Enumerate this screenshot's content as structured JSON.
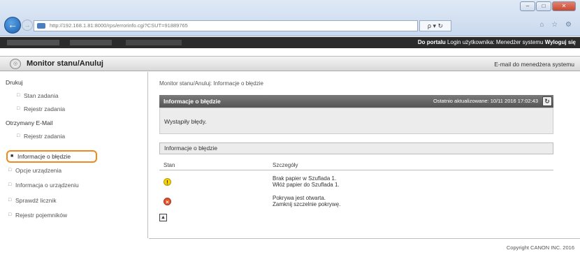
{
  "browser": {
    "url": "http://192.168.1.81:8000/rps/errorinfo.cgi?CSUT=91889765",
    "addr_controls": "ρ ▾ ↻",
    "icons": "⌂ ☆ ⚙",
    "window_buttons": [
      "–",
      "□",
      "✕"
    ]
  },
  "banner": {
    "portal_link": "Do portalu",
    "login_label": "Login użytkownika: Menedżer systemu",
    "logout_link": "Wyloguj się"
  },
  "header": {
    "title": "Monitor stanu/Anuluj",
    "admin_email": "E-mail do menedżera systemu"
  },
  "sidebar": {
    "items": [
      {
        "label": "Drukuj",
        "kind": "group"
      },
      {
        "label": "Stan zadania",
        "kind": "sub"
      },
      {
        "label": "Rejestr zadania",
        "kind": "sub"
      },
      {
        "label": "Otrzymany E-Mail",
        "kind": "group"
      },
      {
        "label": "Rejestr zadania",
        "kind": "sub"
      },
      {
        "label": "Informacje o błędzie",
        "kind": "active"
      },
      {
        "label": "Opcje urządzenia",
        "kind": "top"
      },
      {
        "label": "Informacja o urządzeniu",
        "kind": "top"
      },
      {
        "label": "Sprawdź licznik",
        "kind": "top"
      },
      {
        "label": "Rejestr pojemników",
        "kind": "top"
      }
    ]
  },
  "main": {
    "breadcrumb": "Monitor stanu/Anuluj: Informacje o błędzie",
    "panel_title": "Informacje o błędzie",
    "last_updated": "Ostatnio aktualizowane: 10/11 2016 17:02:43",
    "panel_message": "Wystąpiły błędy.",
    "section_title": "Informacje o błędzie",
    "columns": {
      "status": "Stan",
      "details": "Szczegóły"
    },
    "errors": [
      {
        "icon": "warning-icon",
        "line1": "Brak papier w Szuflada 1.",
        "line2": "Włóż papier do Szuflada 1."
      },
      {
        "icon": "error-icon",
        "line1": "Pokrywa jest otwarta.",
        "line2": "Zamknij szczelnie pokrywę."
      }
    ]
  },
  "footer": {
    "copyright": "Copyright CANON INC. 2016"
  },
  "colors": {
    "highlight": "#f08a1f",
    "warning": "#f5d200",
    "error": "#e8522a",
    "panel_header": "#5a5a5a"
  }
}
